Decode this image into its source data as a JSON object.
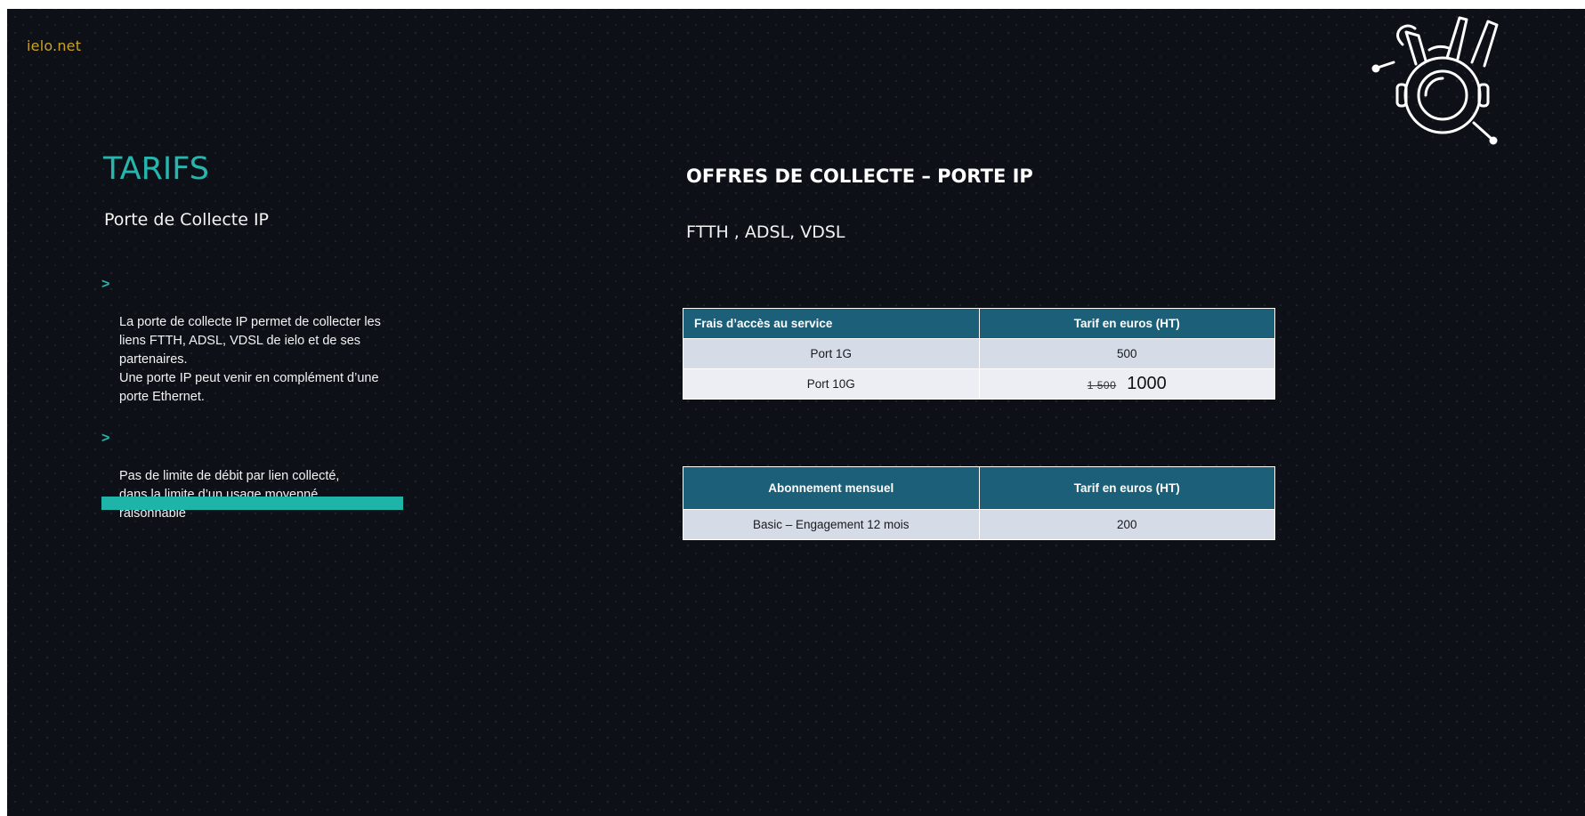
{
  "brand": "ielo.net",
  "slide": {
    "title": "TARIFS",
    "subtitle": "Porte de Collecte IP",
    "bullets": [
      "La porte de collecte IP permet de collecter les\nliens FTTH, ADSL, VDSL de ielo et de ses\npartenaires.\nUne porte IP peut venir en complément d’une\nporte Ethernet.",
      "Pas de limite de débit par lien collecté,\ndans la limite d’un usage moyenné\nraisonnable"
    ],
    "bullet_marker": ">",
    "heading": "OFFRES DE COLLECTE – PORTE IP",
    "technologies": "FTTH , ADSL, VDSL"
  },
  "access_table": {
    "headers": [
      "Frais d’accès au service",
      "Tarif en euros (HT)"
    ],
    "rows": [
      {
        "label": "Port 1G",
        "price": "500"
      },
      {
        "label": "Port 10G",
        "old_price": "1 500",
        "price": "1000"
      }
    ]
  },
  "subscription_table": {
    "headers": [
      "Abonnement mensuel",
      "Tarif en euros (HT)"
    ],
    "rows": [
      {
        "label": "Basic – Engagement 12 mois",
        "price": "200"
      }
    ]
  },
  "colors": {
    "background": "#0d1117",
    "accent_teal": "#27b6ad",
    "brand_gold": "#c9a227",
    "table_header": "#1c5f78"
  },
  "icons": {
    "mascot": "astronaut-icon"
  }
}
